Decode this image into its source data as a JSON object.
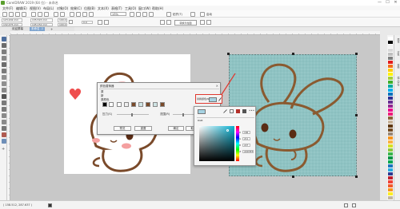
{
  "window": {
    "title": "CorelDRAW 2019 (64 位) - 未命名",
    "controls": [
      "—",
      "☐",
      "✕"
    ]
  },
  "menubar": {
    "items": [
      "文件(F)",
      "编辑(E)",
      "视图(V)",
      "布局(L)",
      "对象(O)",
      "效果(C)",
      "位图(B)",
      "文本(X)",
      "表格(T)",
      "工具(O)",
      "窗口(W)",
      "帮助(H)"
    ]
  },
  "toolbar": {
    "zoom_value": "13%",
    "snap_label": "贴齐(T)",
    "launch_label": "启动"
  },
  "property_bar": {
    "x_value": "123.202 mm",
    "y_value": "132.475 mm",
    "w_value": "135.515 mm",
    "h_value": "145.152 mm",
    "percent_w": "100.0",
    "percent_h": "100.0",
    "angle": "0.0",
    "convert_label": "转换为位图"
  },
  "doc_tabs": [
    "欢迎屏幕",
    "未命名 -1"
  ],
  "statusbar": {
    "coords": "( 158.512, 287.637 )",
    "fill_icon": "fill-icon"
  },
  "dialog": {
    "title": "颜色替换器",
    "close_glyph": "×",
    "tabs": [
      "原",
      "新"
    ],
    "original_label": "原颜色",
    "pressure_label": "压力(S)",
    "range_label": "范围(R)",
    "preview_button": "预览",
    "reset_button": "重置",
    "ok_button": "确定",
    "cancel_button": "取消",
    "help_button": "帮助",
    "replace_color_label": "替换颜色(N)",
    "replace_color_hex": "#a6d3e3"
  },
  "picker": {
    "model_label": "RGB",
    "labels": [
      "R",
      "G",
      "B",
      "#"
    ],
    "values": [
      "166",
      "211",
      "227",
      "A6D3E3"
    ],
    "gradient_hue": "#0db2d3"
  },
  "palette_colors": [
    "#ffffff",
    "#000000",
    "#f2f2f2",
    "#d9d9d9",
    "#bfbfbf",
    "#7f7f7f",
    "#e21c1c",
    "#f46d1a",
    "#ffcc00",
    "#fff200",
    "#a6ce39",
    "#3fae2a",
    "#00a99d",
    "#00aeef",
    "#0071bc",
    "#2e3192",
    "#662d91",
    "#92278f",
    "#ec008c",
    "#ed1e79",
    "#8c6239",
    "#c7b299",
    "#603813",
    "#754c24",
    "#998675",
    "#f7941d",
    "#fbb040",
    "#d7df23",
    "#8dc63f",
    "#39b54a",
    "#009444",
    "#00a651",
    "#1c75bc",
    "#27aae1",
    "#2b3990",
    "#be1e2d",
    "#ef4136",
    "#f15a29",
    "#f7931e",
    "#fcee21",
    "#c2b59b"
  ],
  "side_dock_tabs": [
    "属性",
    "对象",
    "变换",
    "插入字符"
  ],
  "colors": {
    "accent_red": "#e0382f",
    "outline_brown": "#7a4a2a",
    "texture_teal": "#8fc3c3"
  }
}
